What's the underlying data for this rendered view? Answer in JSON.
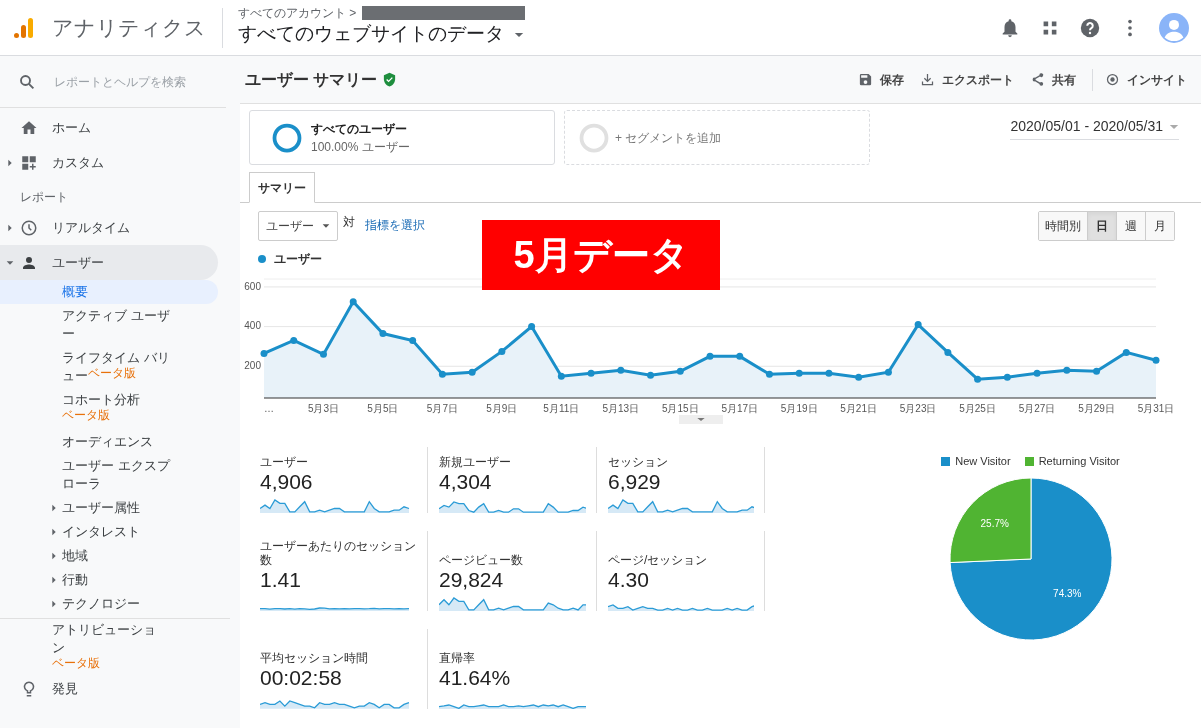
{
  "header": {
    "product": "アナリティクス",
    "breadcrumb": "すべてのアカウント >",
    "view": "すべてのウェブサイトのデータ"
  },
  "sidebar": {
    "search_placeholder": "レポートとヘルプを検索",
    "items": [
      {
        "label": "ホーム",
        "selected": false
      },
      {
        "label": "カスタム",
        "expanded": false,
        "selected": false
      }
    ],
    "section": "レポート",
    "reports": [
      {
        "label": "リアルタイム",
        "expanded": false,
        "selected": false
      },
      {
        "label": "ユーザー",
        "expanded": true,
        "selected": true,
        "children": [
          {
            "label": "概要",
            "selected": true
          },
          {
            "label": "アクティブ ユーザー",
            "selected": false
          },
          {
            "label": "ライフタイム バリュー",
            "badge": "ベータ版",
            "selected": false
          },
          {
            "label": "コホート分析",
            "badge": "ベータ版",
            "selected": false
          },
          {
            "label": "オーディエンス",
            "selected": false
          },
          {
            "label": "ユーザー エクスプローラ",
            "selected": false
          },
          {
            "label": "ユーザー属性",
            "expanded": false,
            "selected": false
          },
          {
            "label": "インタレスト",
            "expanded": false,
            "selected": false
          },
          {
            "label": "地域",
            "expanded": false,
            "selected": false
          },
          {
            "label": "行動",
            "expanded": false,
            "selected": false
          },
          {
            "label": "テクノロジー",
            "expanded": false,
            "selected": false
          }
        ]
      }
    ],
    "footer_items": [
      {
        "label": "アトリビューション",
        "badge": "ベータ版",
        "selected": false
      },
      {
        "label": "発見",
        "selected": false
      }
    ]
  },
  "report": {
    "title": "ユーザー サマリー",
    "actions": [
      "保存",
      "エクスポート",
      "共有",
      "インサイト"
    ],
    "segments": [
      {
        "kind": "segment",
        "title": "すべてのユーザー",
        "subtitle": "100.00% ユーザー"
      },
      {
        "kind": "add",
        "title": "+ セグメントを追加"
      }
    ],
    "date_range": "2020/05/01 - 2020/05/31",
    "tabs": [
      {
        "label": "サマリー",
        "selected": true
      }
    ],
    "metric_select": "ユーザー",
    "versus": "対",
    "choose_metric": "指標を選択",
    "granularity": [
      {
        "label": "時間別",
        "selected": false
      },
      {
        "label": "日",
        "selected": true
      },
      {
        "label": "週",
        "selected": false
      },
      {
        "label": "月",
        "selected": false
      }
    ],
    "overlay_banner": "5月データ",
    "chart_data": {
      "type": "area",
      "grid": true,
      "categories": [
        "…",
        null,
        "5月3日",
        null,
        "5月5日",
        null,
        "5月7日",
        null,
        "5月9日",
        null,
        "5月11日",
        null,
        "5月13日",
        null,
        "5月15日",
        null,
        "5月17日",
        null,
        "5月19日",
        null,
        "5月21日",
        null,
        "5月23日",
        null,
        "5月25日",
        null,
        "5月27日",
        null,
        "5月29日",
        null,
        "5月31日"
      ],
      "series": [
        {
          "name": "ユーザー",
          "color": "#1a8fc9",
          "marker": "circle",
          "values": [
            265,
            330,
            260,
            525,
            365,
            330,
            160,
            170,
            275,
            400,
            150,
            165,
            180,
            155,
            175,
            250,
            250,
            160,
            165,
            165,
            145,
            170,
            410,
            270,
            135,
            145,
            165,
            180,
            175,
            270,
            230
          ]
        }
      ],
      "ylim": [
        40,
        640
      ],
      "yticks": [
        200,
        400,
        600
      ]
    },
    "metrics": [
      {
        "label": "ユーザー",
        "value": "4,906"
      },
      {
        "label": "新規ユーザー",
        "value": "4,304"
      },
      {
        "label": "セッション",
        "value": "6,929"
      },
      {
        "label": "ユーザーあたりのセッション数",
        "value": "1.41"
      },
      {
        "label": "ページビュー数",
        "value": "29,824"
      },
      {
        "label": "ページ/セッション",
        "value": "4.30"
      },
      {
        "label": "平均セッション時間",
        "value": "00:02:58"
      },
      {
        "label": "直帰率",
        "value": "41.64%"
      }
    ],
    "pie": {
      "chart_data": {
        "type": "pie",
        "categories": [
          "New Visitor",
          "Returning Visitor"
        ],
        "values": [
          74.3,
          25.7
        ],
        "colors": [
          "#1a8fc9",
          "#50b432"
        ],
        "value_labels": [
          "74.3%",
          "25.7%"
        ],
        "legend": "top"
      }
    }
  }
}
